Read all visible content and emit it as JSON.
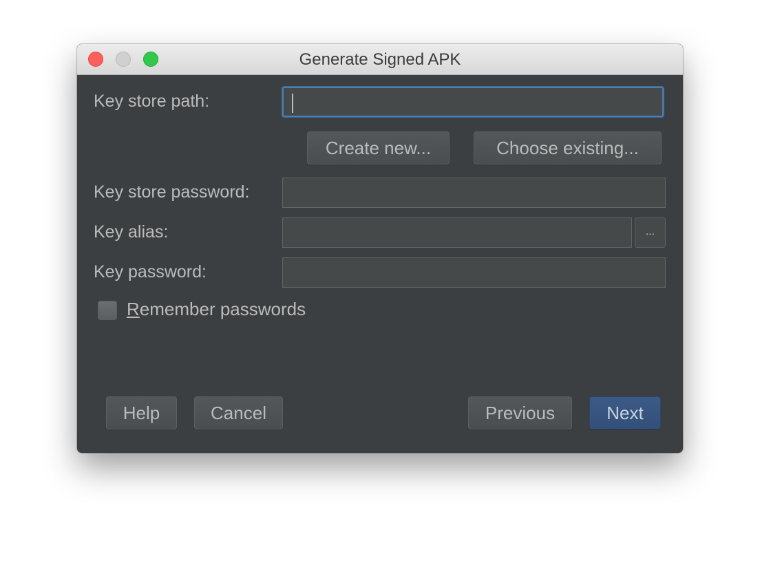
{
  "window": {
    "title": "Generate Signed APK"
  },
  "form": {
    "key_store_path": {
      "label": "Key store path:",
      "value": ""
    },
    "create_new_label": "Create new...",
    "choose_existing_label": "Choose existing...",
    "key_store_password": {
      "label": "Key store password:",
      "value": ""
    },
    "key_alias": {
      "label": "Key alias:",
      "value": "",
      "browse_label": "..."
    },
    "key_password": {
      "label": "Key password:",
      "value": ""
    },
    "remember_passwords": {
      "mnemonic": "R",
      "label_rest": "emember passwords",
      "checked": false
    }
  },
  "footer": {
    "help_label": "Help",
    "cancel_label": "Cancel",
    "previous_label": "Previous",
    "next_label": "Next"
  },
  "colors": {
    "panel_bg": "#3c3f41",
    "field_bg": "#45494a",
    "focus_border": "#4a7fb0",
    "primary_button": "#365880",
    "text": "#bbbbbb"
  }
}
